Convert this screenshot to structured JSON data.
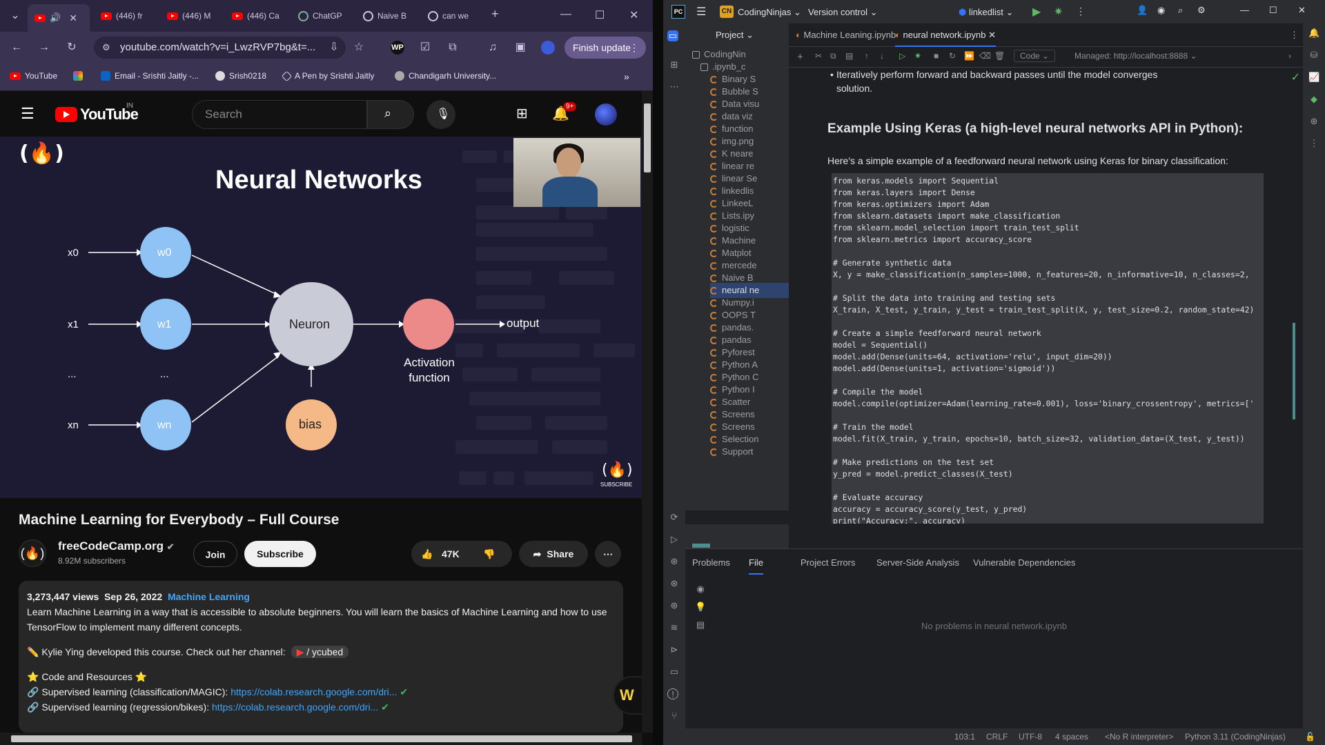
{
  "chrome": {
    "tabs": [
      {
        "label": ""
      },
      {
        "label": "(446) fr"
      },
      {
        "label": "(446) M"
      },
      {
        "label": "(446) Ca"
      },
      {
        "label": "ChatGP"
      },
      {
        "label": "Naive B"
      },
      {
        "label": "can we"
      }
    ],
    "url": "youtube.com/watch?v=i_LwzRVP7bg&t=...",
    "finish_update": "Finish update",
    "bookmarks": [
      "YouTube",
      "",
      "Email - Srishti Jaitly -...",
      "Srish0218",
      "A Pen by Srishti Jaitly",
      "Chandigarh University..."
    ]
  },
  "youtube": {
    "logo_text": "YouTube",
    "country": "IN",
    "search_placeholder": "Search",
    "notif_count": "9+",
    "video": {
      "slide_title": "Neural Networks",
      "inputs": [
        "x0",
        "x1",
        "...",
        "xn"
      ],
      "weights": [
        "w0",
        "w1",
        "...",
        "wn"
      ],
      "neuron": "Neuron",
      "activation_line1": "Activation",
      "activation_line2": "function",
      "output": "output",
      "bias": "bias",
      "subscribe_badge": "SUBSCRIBE"
    },
    "title": "Machine Learning for Everybody – Full Course",
    "channel": "freeCodeCamp.org",
    "subscribers": "8.92M subscribers",
    "join": "Join",
    "subscribe": "Subscribe",
    "likes": "47K",
    "share": "Share",
    "views": "3,273,447 views",
    "date": "Sep 26, 2022",
    "tag": "Machine Learning",
    "description": "Learn Machine Learning in a way that is accessible to absolute beginners. You will learn the basics of Machine Learning and how to use TensorFlow to implement many different concepts.",
    "kylie_line": "Kylie Ying developed this course. Check out her channel:",
    "kylie_handle": "/ ycubed",
    "code_resources": "Code and Resources",
    "link1_label": "Supervised learning (classification/MAGIC):",
    "link1_url": "https://colab.research.google.com/dri...",
    "link2_label": "Supervised learning (regression/bikes):",
    "link2_url": "https://colab.research.google.com/dri..."
  },
  "ide": {
    "project_name": "CodingNinjas",
    "project_badge": "CN",
    "version_control": "Version control",
    "branch": "linkedlist",
    "project_label": "Project",
    "tabs": [
      "Machine Leaning.ipynb",
      "neural network.ipynb"
    ],
    "tree": [
      "CodingNin",
      ".ipynb_c",
      "Binary S",
      "Bubble S",
      "Data visu",
      "data viz",
      "function",
      "img.png",
      "K neare",
      "linear re",
      "linear Se",
      "linkedlis",
      "LinkeeL",
      "Lists.ipy",
      "logistic",
      "Machine",
      "Matplot",
      "mercede",
      "Naive B",
      "neural ne",
      "Numpy.i",
      "OOPS T",
      "pandas.",
      "pandas",
      "Pyforest",
      "Python A",
      "Python C",
      "Python I",
      "Scatter",
      "Screens",
      "Screens",
      "Selection",
      "Support"
    ],
    "cell_type": "Code",
    "kernel": "Managed: http://localhost:8888",
    "bullet": "Iteratively perform forward and backward passes until the model converges to a satisfactory solution.",
    "bullet_line1": "Iteratively perform forward and backward passes until the model converges",
    "bullet_line2": "solution.",
    "heading": "Example Using Keras (a high-level neural networks API in Python):",
    "intro": "Here's a simple example of a feedforward neural network using Keras for binary classification:",
    "code": "from keras.models import Sequential\nfrom keras.layers import Dense\nfrom keras.optimizers import Adam\nfrom sklearn.datasets import make_classification\nfrom sklearn.model_selection import train_test_split\nfrom sklearn.metrics import accuracy_score\n\n# Generate synthetic data\nX, y = make_classification(n_samples=1000, n_features=20, n_informative=10, n_classes=2,\n\n# Split the data into training and testing sets\nX_train, X_test, y_train, y_test = train_test_split(X, y, test_size=0.2, random_state=42)\n\n# Create a simple feedforward neural network\nmodel = Sequential()\nmodel.add(Dense(units=64, activation='relu', input_dim=20))\nmodel.add(Dense(units=1, activation='sigmoid'))\n\n# Compile the model\nmodel.compile(optimizer=Adam(learning_rate=0.001), loss='binary_crossentropy', metrics=['\n\n# Train the model\nmodel.fit(X_train, y_train, epochs=10, batch_size=32, validation_data=(X_test, y_test))\n\n# Make predictions on the test set\ny_pred = model.predict_classes(X_test)\n\n# Evaluate accuracy\naccuracy = accuracy_score(y_test, y_pred)\nprint(\"Accuracy:\", accuracy)",
    "bottom_tabs": [
      "Problems",
      "File",
      "Project Errors",
      "Server-Side Analysis",
      "Vulnerable Dependencies"
    ],
    "no_problems": "No problems in neural network.ipynb",
    "status": [
      "103:1",
      "CRLF",
      "UTF-8",
      "4 spaces",
      "<No R interpreter>",
      "Python 3.11 (CodingNinjas)"
    ]
  }
}
